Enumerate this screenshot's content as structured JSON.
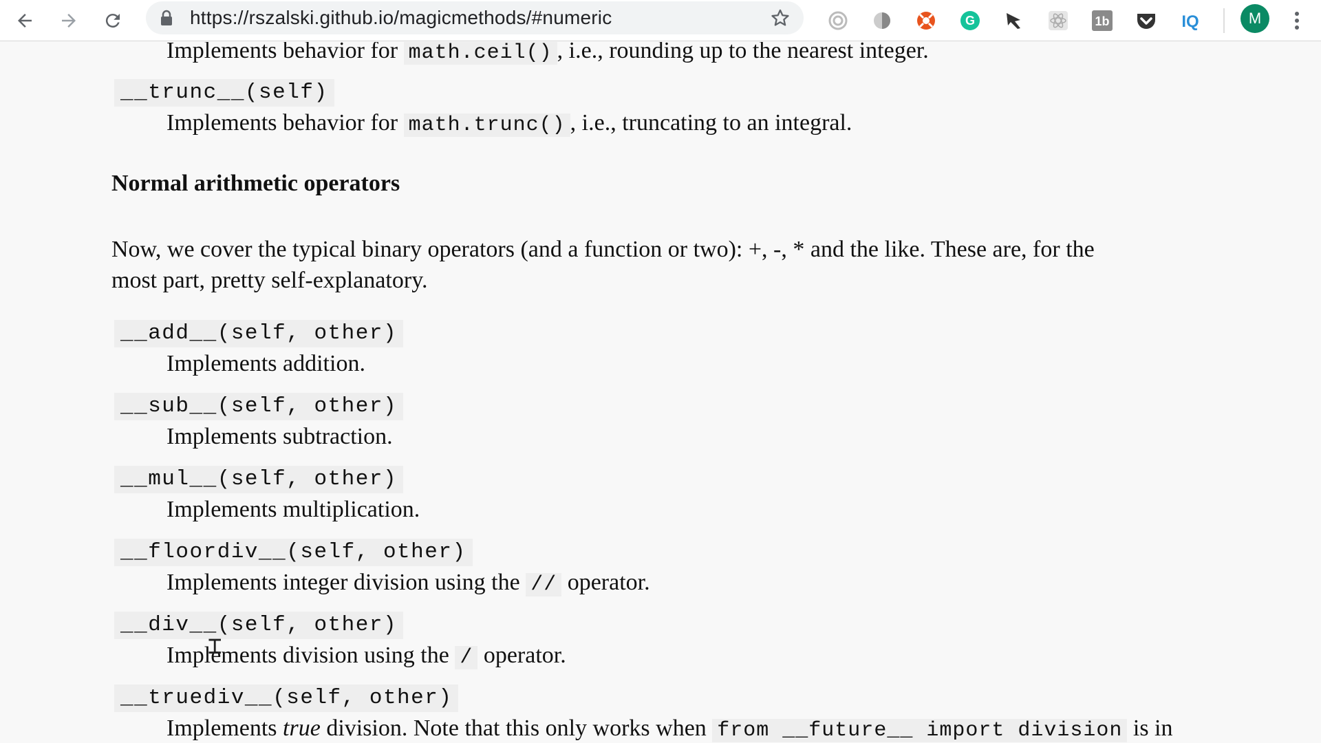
{
  "browser": {
    "url": "https://rszalski.github.io/magicmethods/#numeric",
    "avatar_letter": "M",
    "extensions": [
      {
        "name": "target-extension-icon",
        "color": "#aaaaaa"
      },
      {
        "name": "shield-extension-icon",
        "color": "#999999"
      },
      {
        "name": "lifering-extension-icon",
        "color": "#e8541e"
      },
      {
        "name": "grammarly-extension-icon",
        "color": "#15c39a"
      },
      {
        "name": "flag-extension-icon",
        "color": "#333333"
      },
      {
        "name": "react-extension-icon",
        "color": "#bbbbbb"
      },
      {
        "name": "tb-extension-icon",
        "color": "#888888"
      },
      {
        "name": "pocket-extension-icon",
        "color": "#333333"
      },
      {
        "name": "iq-extension-icon",
        "color": "#2a8fd8"
      }
    ]
  },
  "content": {
    "ceil_desc": {
      "pre": "Implements behavior for ",
      "code": "math.ceil()",
      "post": ", i.e., rounding up to the nearest integer."
    },
    "trunc": {
      "signature": "__trunc__(self)",
      "pre": "Implements behavior for ",
      "code": "math.trunc()",
      "post": ", i.e., truncating to an integral."
    },
    "heading": "Normal arithmetic operators",
    "intro_line1": "Now, we cover the typical binary operators (and a function or two): +, -, * and the like. These are, for the",
    "intro_line2": "most part, pretty self-explanatory.",
    "methods": [
      {
        "signature": "__add__(self, other)",
        "desc": "Implements addition."
      },
      {
        "signature": "__sub__(self, other)",
        "desc": "Implements subtraction."
      },
      {
        "signature": "__mul__(self, other)",
        "desc": "Implements multiplication."
      }
    ],
    "floordiv": {
      "signature": "__floordiv__(self, other)",
      "pre": "Implements integer division using the ",
      "code": "//",
      "post": " operator."
    },
    "div": {
      "signature": "__div__(self, other)",
      "pre": "Implements division using the ",
      "code": "/",
      "post": " operator."
    },
    "truediv": {
      "signature": "__truediv__(self, other)",
      "pre": "Implements ",
      "em": "true",
      "mid": " division. Note that this only works when ",
      "code": "from __future__ import division",
      "post": " is in"
    }
  }
}
